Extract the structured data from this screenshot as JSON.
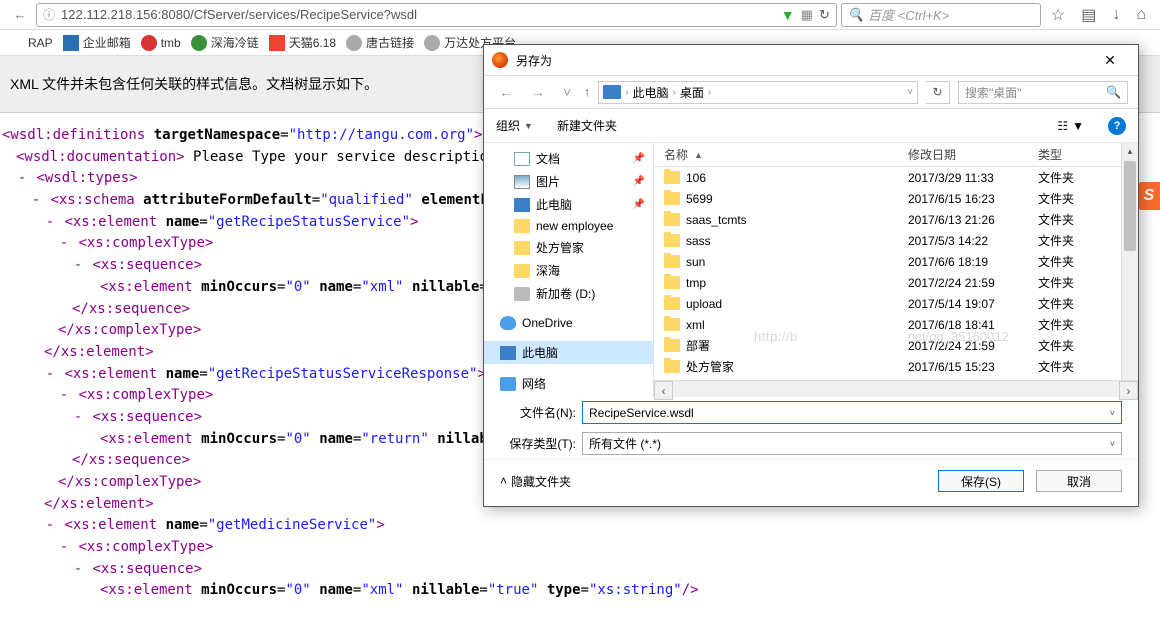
{
  "browser": {
    "url": "122.112.218.156:8080/CfServer/services/RecipeService?wsdl",
    "search_placeholder": "百度 <Ctrl+K>",
    "bookmarks": [
      {
        "label": "RAP",
        "icon": "bi-rap"
      },
      {
        "label": "企业邮箱",
        "icon": "bi-blue"
      },
      {
        "label": "tmb",
        "icon": "bi-red"
      },
      {
        "label": "深海冷链",
        "icon": "bi-green"
      },
      {
        "label": "天猫6.18",
        "icon": "bi-redt"
      },
      {
        "label": "唐古链接",
        "icon": "bi-gray"
      },
      {
        "label": "万达处方平台",
        "icon": "bi-gray"
      }
    ]
  },
  "page": {
    "banner": "XML 文件并未包含任何关联的样式信息。文档树显示如下。",
    "lines": [
      {
        "ind": 0,
        "html": "<span class='tag'>&lt;wsdl:definitions</span> <span class='attr-name'>targetNamespace</span>=<span class='attr-val'>\"http://tangu.com.org\"</span><span class='tag'>&gt;</span>"
      },
      {
        "ind": 1,
        "html": "<span class='tag'>&lt;wsdl:documentation&gt;</span> <span class='text-content'>Please Type your service description</span>"
      },
      {
        "ind": 1,
        "toggle": "-",
        "html": "<span class='tag'>&lt;wsdl:types&gt;</span>"
      },
      {
        "ind": 2,
        "toggle": "-",
        "html": "<span class='tag'>&lt;xs:schema</span> <span class='attr-name'>attributeFormDefault</span>=<span class='attr-val'>\"qualified\"</span> <span class='attr-name'>elementFor</span>"
      },
      {
        "ind": 3,
        "toggle": "-",
        "html": "<span class='tag'>&lt;xs:element</span> <span class='attr-name'>name</span>=<span class='attr-val'>\"getRecipeStatusService\"</span><span class='tag'>&gt;</span>"
      },
      {
        "ind": 4,
        "toggle": "-",
        "html": "<span class='tag'>&lt;xs:complexType&gt;</span>"
      },
      {
        "ind": 5,
        "toggle": "-",
        "html": "<span class='tag'>&lt;xs:sequence&gt;</span>"
      },
      {
        "ind": 6,
        "html": "<span class='tag'>&lt;xs:element</span> <span class='attr-name'>minOccurs</span>=<span class='attr-val'>\"0\"</span> <span class='attr-name'>name</span>=<span class='attr-val'>\"xml\"</span> <span class='attr-name'>nillable</span>="
      },
      {
        "ind": 5,
        "html": "<span class='tag'>&lt;/xs:sequence&gt;</span>"
      },
      {
        "ind": 4,
        "html": "<span class='tag'>&lt;/xs:complexType&gt;</span>"
      },
      {
        "ind": 3,
        "html": "<span class='tag'>&lt;/xs:element&gt;</span>"
      },
      {
        "ind": 3,
        "toggle": "-",
        "html": "<span class='tag'>&lt;xs:element</span> <span class='attr-name'>name</span>=<span class='attr-val'>\"getRecipeStatusServiceResponse\"</span><span class='tag'>&gt;</span>"
      },
      {
        "ind": 4,
        "toggle": "-",
        "html": "<span class='tag'>&lt;xs:complexType&gt;</span>"
      },
      {
        "ind": 5,
        "toggle": "-",
        "html": "<span class='tag'>&lt;xs:sequence&gt;</span>"
      },
      {
        "ind": 6,
        "html": "<span class='tag'>&lt;xs:element</span> <span class='attr-name'>minOccurs</span>=<span class='attr-val'>\"0\"</span> <span class='attr-name'>name</span>=<span class='attr-val'>\"return\"</span> <span class='attr-name'>nillab</span>"
      },
      {
        "ind": 5,
        "html": "<span class='tag'>&lt;/xs:sequence&gt;</span>"
      },
      {
        "ind": 4,
        "html": "<span class='tag'>&lt;/xs:complexType&gt;</span>"
      },
      {
        "ind": 3,
        "html": "<span class='tag'>&lt;/xs:element&gt;</span>"
      },
      {
        "ind": 3,
        "toggle": "-",
        "html": "<span class='tag'>&lt;xs:element</span> <span class='attr-name'>name</span>=<span class='attr-val'>\"getMedicineService\"</span><span class='tag'>&gt;</span>"
      },
      {
        "ind": 4,
        "toggle": "-",
        "html": "<span class='tag'>&lt;xs:complexType&gt;</span>"
      },
      {
        "ind": 5,
        "toggle": "-",
        "html": "<span class='tag'>&lt;xs:sequence&gt;</span>"
      },
      {
        "ind": 6,
        "html": "<span class='tag'>&lt;xs:element</span> <span class='attr-name'>minOccurs</span>=<span class='attr-val'>\"0\"</span> <span class='attr-name'>name</span>=<span class='attr-val'>\"xml\"</span> <span class='attr-name'>nillable</span>=<span class='attr-val'>\"true\"</span> <span class='attr-name'>type</span>=<span class='attr-val'>\"xs:string\"</span><span class='tag'>/&gt;</span>"
      }
    ]
  },
  "dialog": {
    "title": "另存为",
    "path": [
      "此电脑",
      "桌面"
    ],
    "search_placeholder": "搜索\"桌面\"",
    "toolbar": {
      "organize": "组织",
      "new_folder": "新建文件夹"
    },
    "nav": [
      {
        "label": "文档",
        "icon": "ni-doc",
        "pin": true
      },
      {
        "label": "图片",
        "icon": "ni-pic",
        "pin": true
      },
      {
        "label": "此电脑",
        "icon": "ni-pc",
        "pin": true
      },
      {
        "label": "new employee",
        "icon": "ni-folder"
      },
      {
        "label": "处方管家",
        "icon": "ni-folder"
      },
      {
        "label": "深海",
        "icon": "ni-folder"
      },
      {
        "label": "新加卷 (D:)",
        "icon": "ni-drive"
      }
    ],
    "nav_top": [
      {
        "label": "OneDrive",
        "icon": "ni-cloud"
      },
      {
        "label": "此电脑",
        "icon": "ni-pc",
        "sel": true
      },
      {
        "label": "网络",
        "icon": "ni-net"
      }
    ],
    "columns": {
      "name": "名称",
      "date": "修改日期",
      "type": "类型"
    },
    "files": [
      {
        "name": "106",
        "date": "2017/3/29 11:33",
        "type": "文件夹"
      },
      {
        "name": "5699",
        "date": "2017/6/15 16:23",
        "type": "文件夹"
      },
      {
        "name": "saas_tcmts",
        "date": "2017/6/13 21:26",
        "type": "文件夹"
      },
      {
        "name": "sass",
        "date": "2017/5/3 14:22",
        "type": "文件夹"
      },
      {
        "name": "sun",
        "date": "2017/6/6 18:19",
        "type": "文件夹"
      },
      {
        "name": "tmp",
        "date": "2017/2/24 21:59",
        "type": "文件夹"
      },
      {
        "name": "upload",
        "date": "2017/5/14 19:07",
        "type": "文件夹"
      },
      {
        "name": "xml",
        "date": "2017/6/18 18:41",
        "type": "文件夹"
      },
      {
        "name": "部署",
        "date": "2017/2/24 21:59",
        "type": "文件夹"
      },
      {
        "name": "处方管家",
        "date": "2017/6/15 15:23",
        "type": "文件夹"
      }
    ],
    "filename_label": "文件名(N):",
    "filename_value": "RecipeService.wsdl",
    "filetype_label": "保存类型(T):",
    "filetype_value": "所有文件 (*.*)",
    "hide_folders": "隐藏文件夹",
    "save": "保存(S)",
    "cancel": "取消",
    "watermark1": "http://b",
    "watermark2": ".net/qq_35160012"
  },
  "badge": "S"
}
